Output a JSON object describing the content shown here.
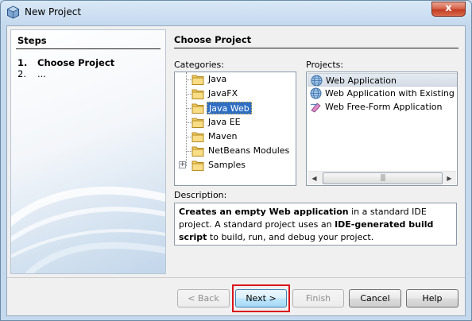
{
  "window": {
    "title": "New Project",
    "close_label": "x"
  },
  "steps": {
    "title": "Steps",
    "items": [
      {
        "number": "1.",
        "label": "Choose Project"
      },
      {
        "number": "2.",
        "label": "..."
      }
    ]
  },
  "main": {
    "title": "Choose Project",
    "categories_label": "Categories:",
    "projects_label": "Projects:",
    "description_label": "Description:"
  },
  "categories": [
    {
      "label": "Java"
    },
    {
      "label": "JavaFX"
    },
    {
      "label": "Java Web",
      "selected": true
    },
    {
      "label": "Java EE"
    },
    {
      "label": "Maven"
    },
    {
      "label": "NetBeans Modules"
    },
    {
      "label": "Samples",
      "expandable": true
    }
  ],
  "projects": [
    {
      "label": "Web Application",
      "icon": "globe-icon",
      "selected": true
    },
    {
      "label": "Web Application with Existing Sources",
      "icon": "globe-icon"
    },
    {
      "label": "Web Free-Form Application",
      "icon": "freeform-web-icon"
    }
  ],
  "scrollbar": {
    "left_arrow": "◀",
    "right_arrow": "▶",
    "thumb_grip": "|||"
  },
  "description": {
    "part1_bold": "Creates an empty Web application",
    "part2": " in a standard IDE project. A standard project uses an ",
    "part3_bold": "IDE-generated build script",
    "part4": " to build, run, and debug your project."
  },
  "buttons": {
    "back": "< Back",
    "next": "Next >",
    "finish": "Finish",
    "cancel": "Cancel",
    "help": "Help"
  },
  "colors": {
    "selection": "#2f6fc3",
    "highlight_box": "#d9151b"
  }
}
